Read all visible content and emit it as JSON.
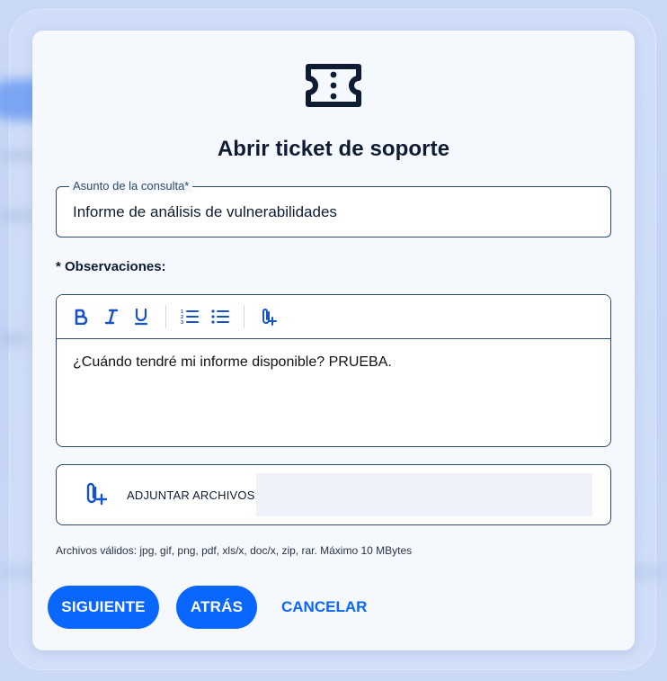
{
  "modal": {
    "title": "Abrir ticket de soporte",
    "icon": "ticket-icon"
  },
  "subject": {
    "legend": "Asunto de la consulta*",
    "value": "Informe de análisis de vulnerabilidades"
  },
  "observations": {
    "label": "* Observaciones:",
    "toolbar": [
      "bold-icon",
      "italic-icon",
      "underline-icon",
      "ordered-list-icon",
      "bullet-list-icon",
      "attach-icon"
    ],
    "content": "¿Cuándo tendré mi informe disponible? PRUEBA."
  },
  "attachments": {
    "label": "ADJUNTAR ARCHIVOS:",
    "icon": "paperclip-plus-icon",
    "hint": "Archivos válidos: jpg, gif, png, pdf, xls/x, doc/x, zip, rar. Máximo 10 MBytes"
  },
  "actions": {
    "next": "SIGUIENTE",
    "back": "ATRÁS",
    "cancel": "CANCELAR"
  },
  "colors": {
    "primary": "#0966ff",
    "icon": "#1554c8",
    "text": "#0e1c33",
    "border": "#2c4a6e"
  }
}
